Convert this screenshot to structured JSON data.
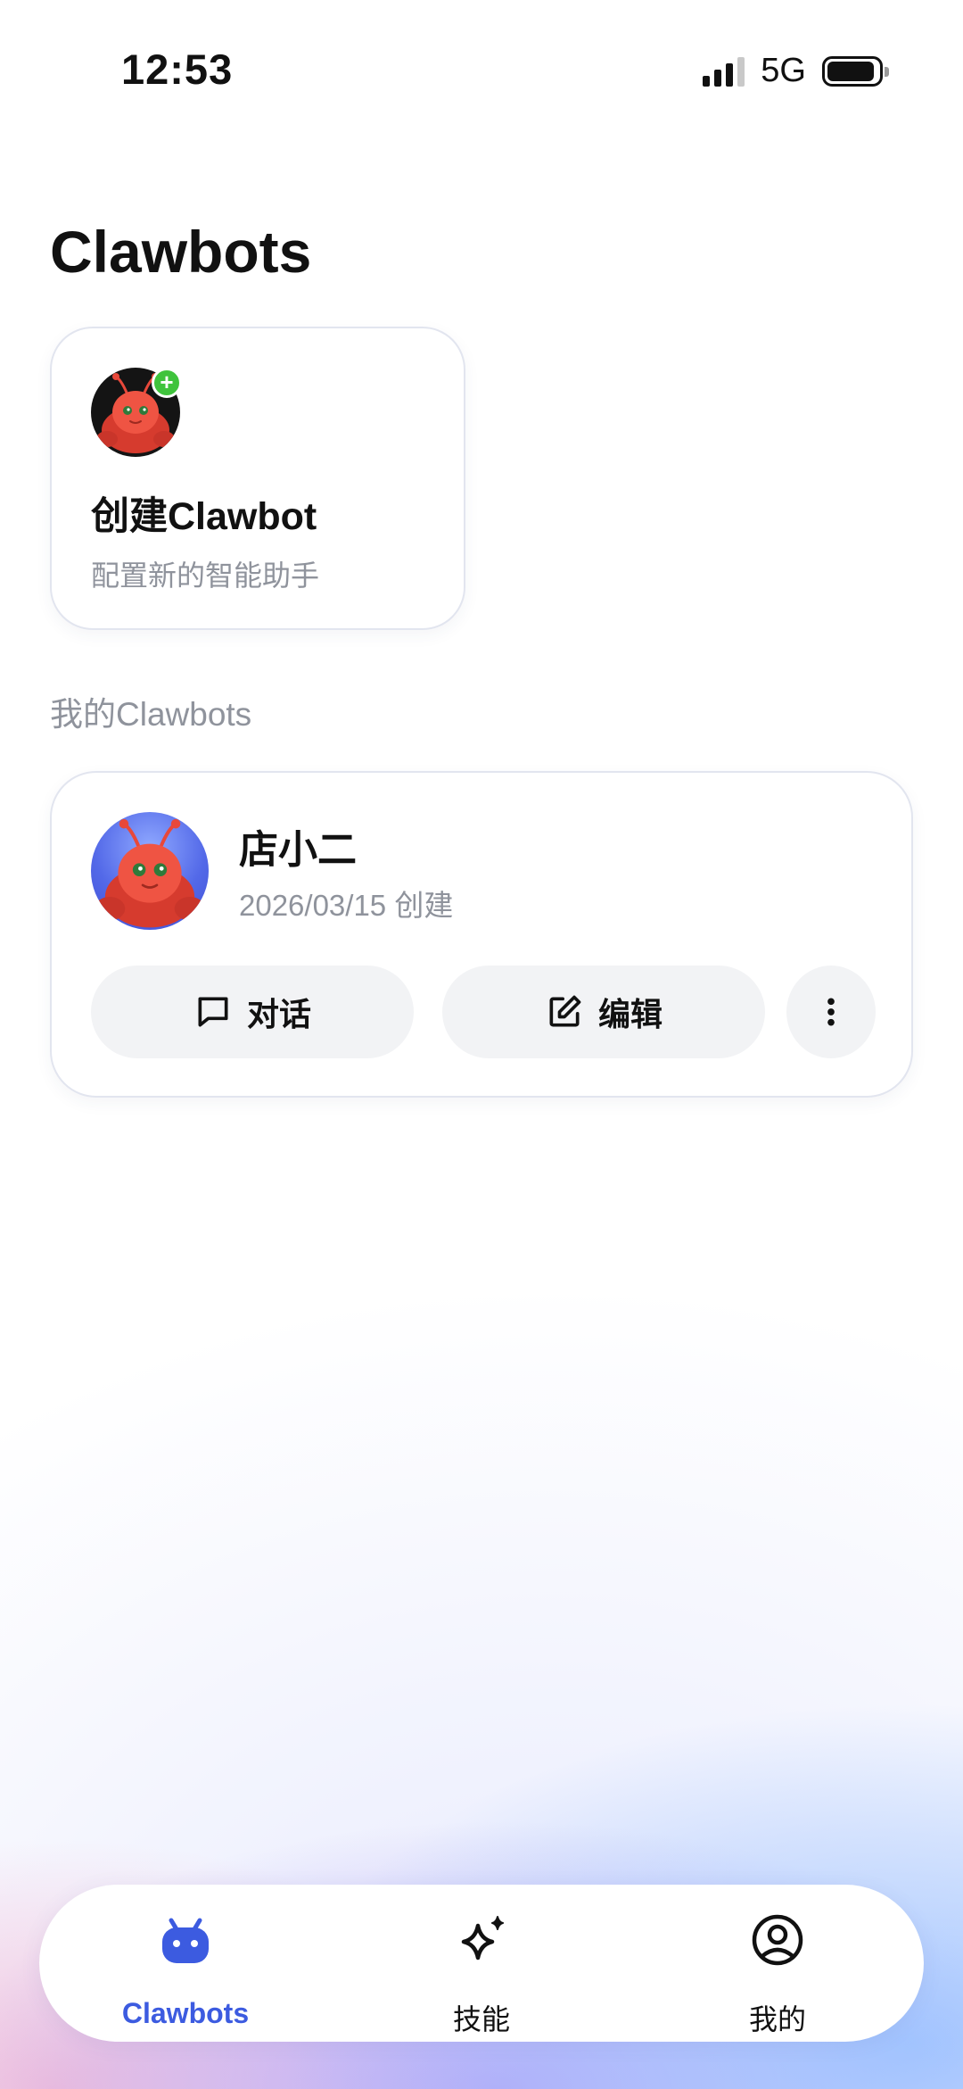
{
  "status_bar": {
    "time": "12:53",
    "network": "5G"
  },
  "page": {
    "title": "Clawbots"
  },
  "create_card": {
    "title": "创建Clawbot",
    "subtitle": "配置新的智能助手",
    "badge": "+"
  },
  "section": {
    "label": "我的Clawbots"
  },
  "bots": [
    {
      "name": "店小二",
      "created": "2026/03/15 创建",
      "chat_label": "对话",
      "edit_label": "编辑"
    }
  ],
  "nav": {
    "items": [
      {
        "label": "Clawbots",
        "icon": "robot-icon",
        "active": true
      },
      {
        "label": "技能",
        "icon": "sparkle-icon",
        "active": false
      },
      {
        "label": "我的",
        "icon": "user-circle-icon",
        "active": false
      }
    ]
  },
  "colors": {
    "accent": "#3C5BE0",
    "badge_green": "#3FC33C",
    "mascot_red": "#E8483A"
  }
}
